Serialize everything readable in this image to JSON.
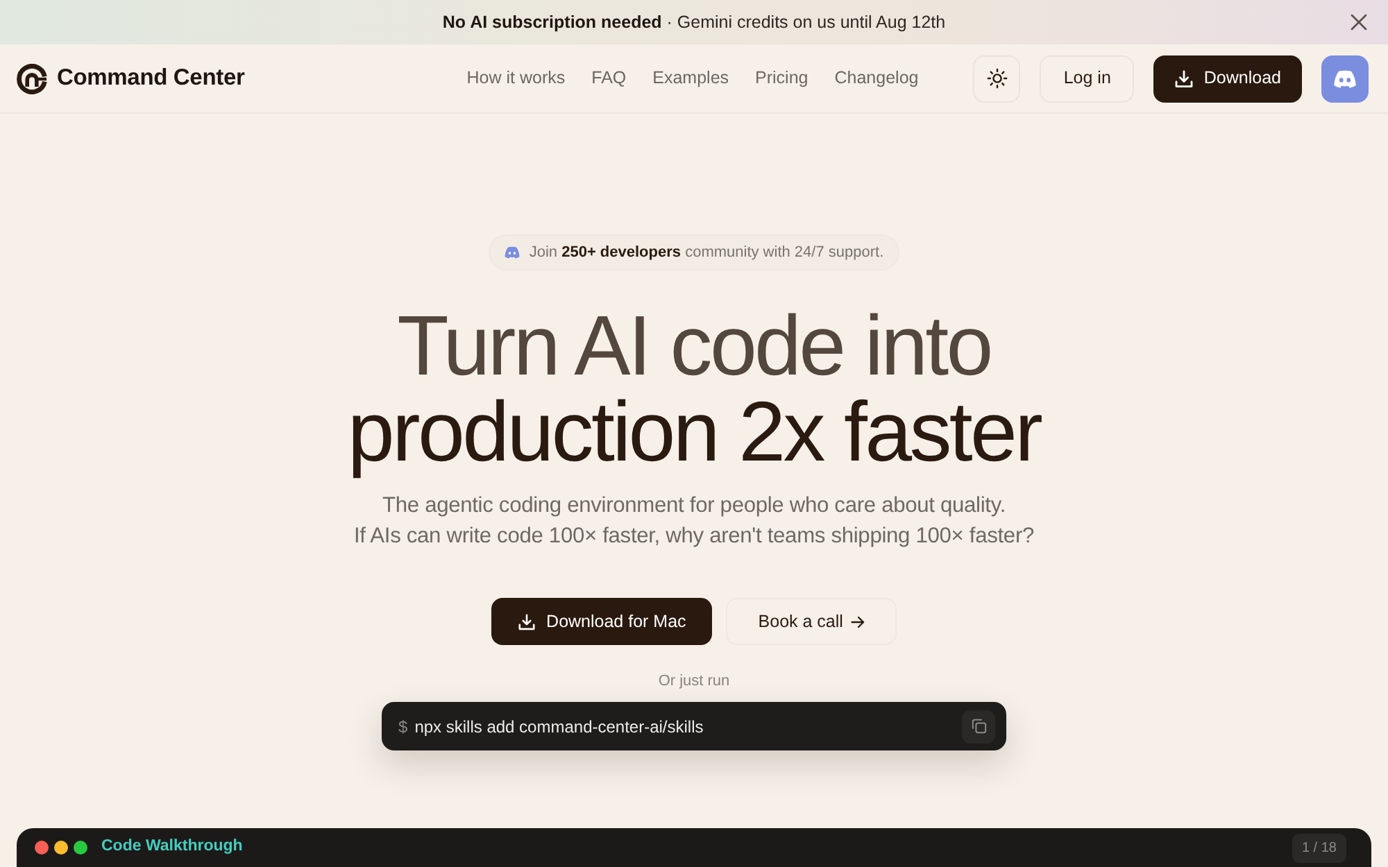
{
  "announcement": {
    "text": "**No AI subscription needed** · Gemini credits on us until Aug 12th"
  },
  "navbar": {
    "brand": "Command Center",
    "links": [
      "How it works",
      "FAQ",
      "Examples",
      "Pricing",
      "Changelog"
    ],
    "login_button": "Log in",
    "download_button": "Download"
  },
  "hero": {
    "community_note": "Join **250+ developers** community with 24/7 support.",
    "headline": [
      "Turn AI code into",
      "production 2x faster"
    ],
    "subtitle": [
      "The agentic coding environment for people who care about quality.",
      "If AIs can write code 100× faster, why aren't teams shipping 100× faster?"
    ],
    "primary_button": "Download for Mac",
    "secondary_button": "Book a call",
    "install_label": "Or just run",
    "command": {
      "prompt": "$",
      "text": "npx skills add command-center-ai/skills"
    }
  },
  "walkthrough": {
    "title": "Code Walkthrough",
    "counter": "1 / 18"
  }
}
